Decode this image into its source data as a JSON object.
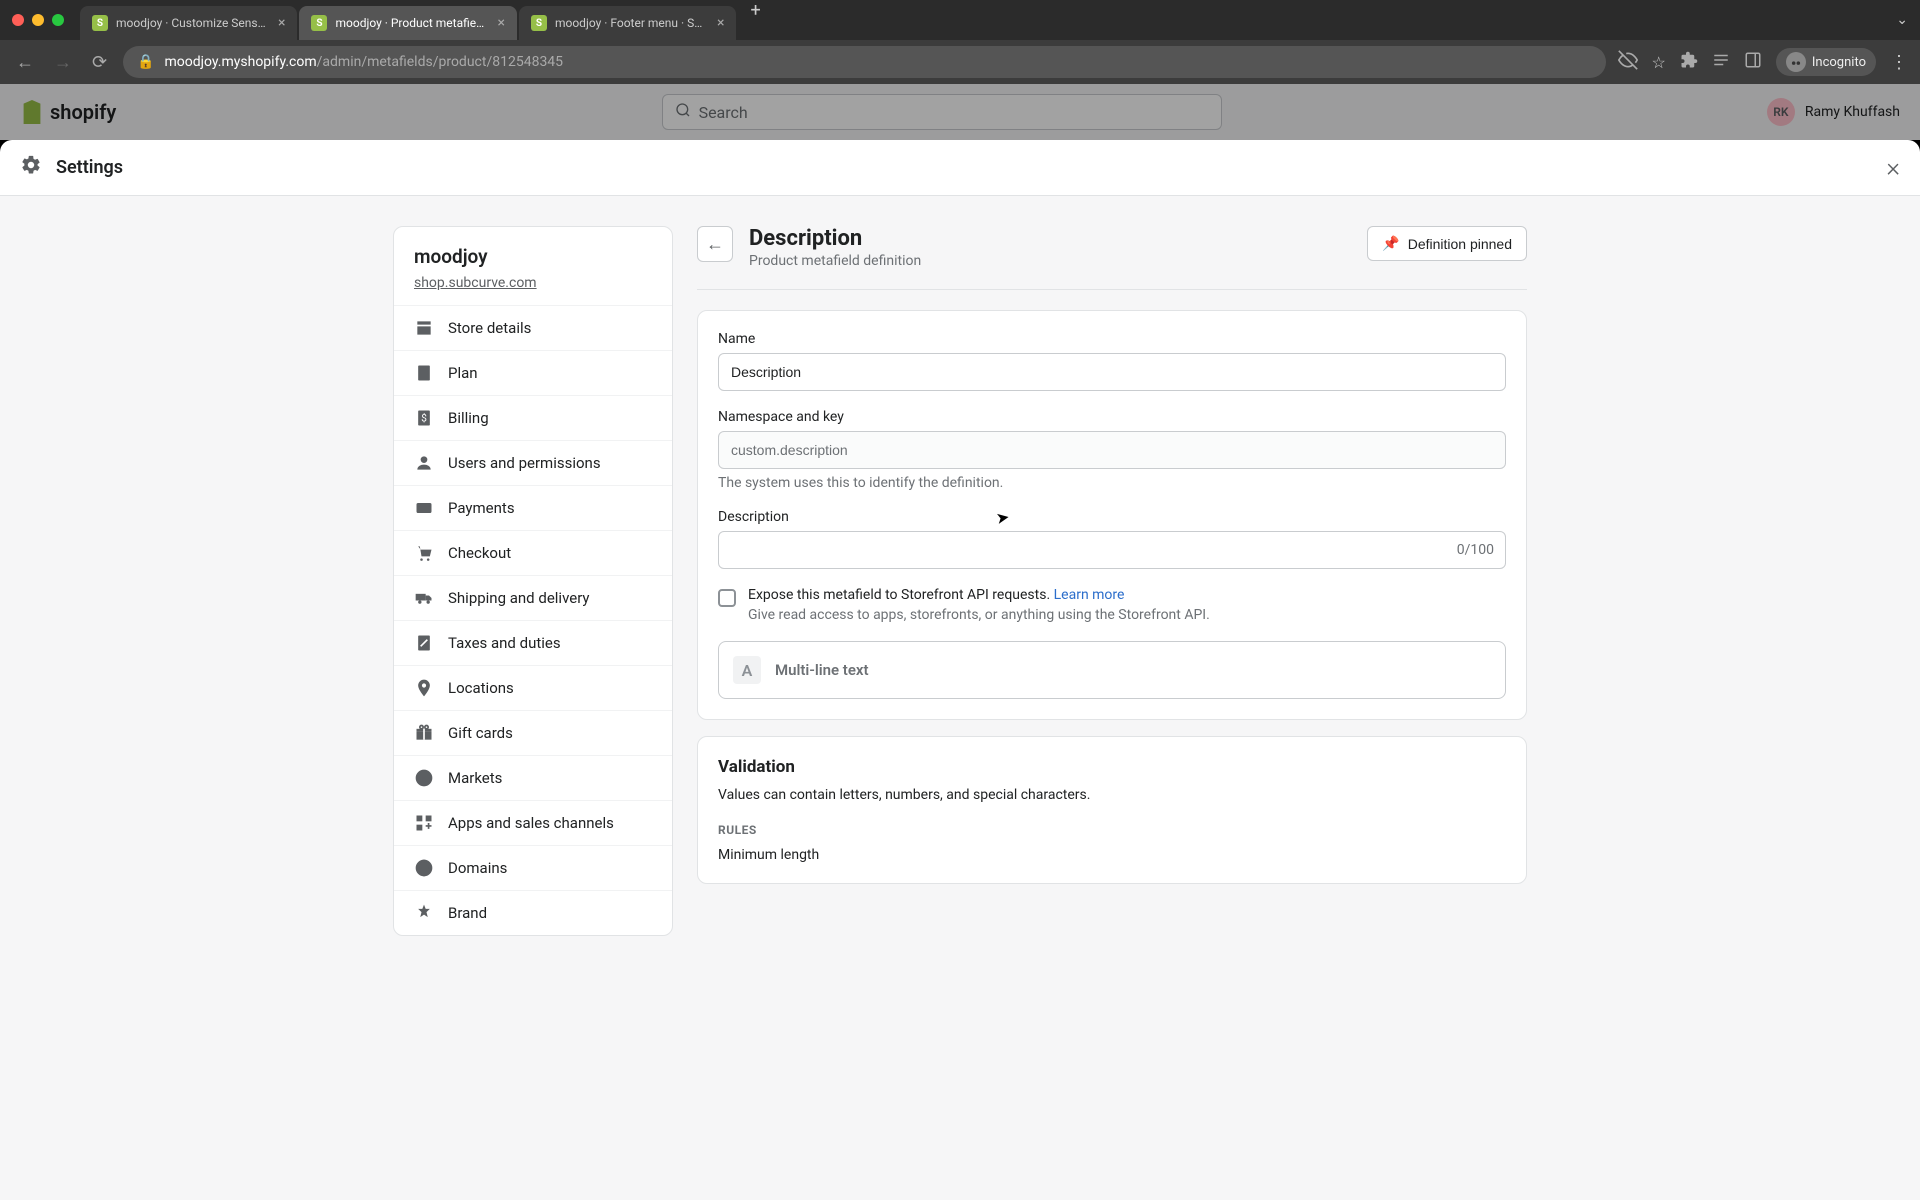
{
  "browser": {
    "tabs": [
      {
        "title": "moodjoy · Customize Sense · S"
      },
      {
        "title": "moodjoy · Product metafield de"
      },
      {
        "title": "moodjoy · Footer menu · Shopi"
      }
    ],
    "url_host": "moodjoy.myshopify.com",
    "url_path": "/admin/metafields/product/812548345",
    "incognito": "Incognito"
  },
  "shopify": {
    "logo_text": "shopify",
    "search_placeholder": "Search",
    "user_initials": "RK",
    "user_name": "Ramy Khuffash"
  },
  "settings": {
    "title": "Settings"
  },
  "sidebar": {
    "store_name": "moodjoy",
    "store_url": "shop.subcurve.com",
    "items": [
      {
        "label": "Store details"
      },
      {
        "label": "Plan"
      },
      {
        "label": "Billing"
      },
      {
        "label": "Users and permissions"
      },
      {
        "label": "Payments"
      },
      {
        "label": "Checkout"
      },
      {
        "label": "Shipping and delivery"
      },
      {
        "label": "Taxes and duties"
      },
      {
        "label": "Locations"
      },
      {
        "label": "Gift cards"
      },
      {
        "label": "Markets"
      },
      {
        "label": "Apps and sales channels"
      },
      {
        "label": "Domains"
      },
      {
        "label": "Brand"
      }
    ]
  },
  "page": {
    "title": "Description",
    "subtitle": "Product metafield definition",
    "pinned_label": "Definition pinned"
  },
  "form": {
    "name_label": "Name",
    "name_value": "Description",
    "namespace_label": "Namespace and key",
    "namespace_value": "custom.description",
    "namespace_help": "The system uses this to identify the definition.",
    "description_label": "Description",
    "description_value": "",
    "description_count": "0/100",
    "expose_label": "Expose this metafield to Storefront API requests. ",
    "expose_link": "Learn more",
    "expose_help": "Give read access to apps, storefronts, or anything using the Storefront API.",
    "type_icon_letter": "A",
    "type_label": "Multi-line text"
  },
  "validation": {
    "title": "Validation",
    "text": "Values can contain letters, numbers, and special characters.",
    "rules_label": "RULES",
    "rule1": "Minimum length"
  }
}
